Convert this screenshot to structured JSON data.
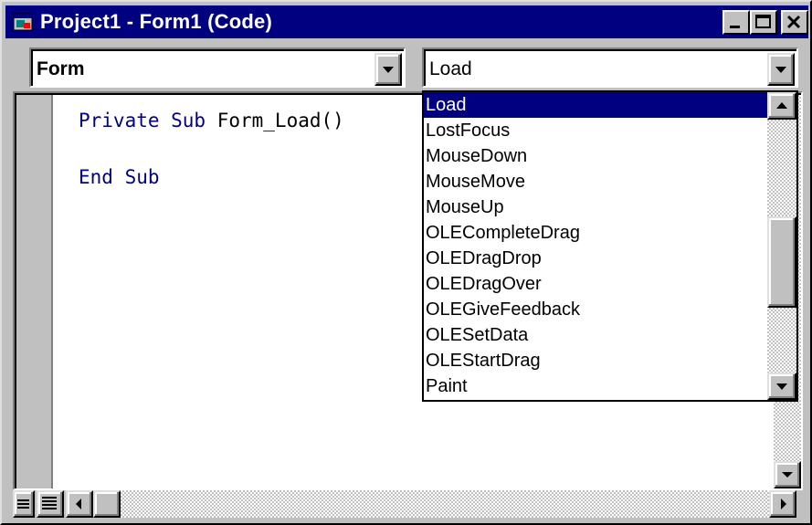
{
  "window": {
    "title": "Project1 - Form1 (Code)",
    "title_bg_color": "#000080",
    "face_color": "#c0c0c0"
  },
  "object_combo": {
    "value": "Form"
  },
  "procedure_combo": {
    "value": "Load",
    "expanded": true,
    "items": [
      "Load",
      "LostFocus",
      "MouseDown",
      "MouseMove",
      "MouseUp",
      "OLECompleteDrag",
      "OLEDragDrop",
      "OLEDragOver",
      "OLEGiveFeedback",
      "OLESetData",
      "OLEStartDrag",
      "Paint"
    ],
    "selected_index": 0,
    "selection_color": "#000080",
    "scroll_position": 0.6
  },
  "code": {
    "keyword_color": "#000080",
    "line1": {
      "kw": "Private Sub",
      "rest": " Form_Load()"
    },
    "line2": {
      "kw": "End Sub"
    }
  },
  "icons": {
    "app": "vb-form-icon",
    "minimize": "minimize-icon",
    "maximize": "maximize-icon",
    "close": "close-icon",
    "procedure_view": "procedure-view-icon",
    "full_module_view": "full-module-view-icon"
  }
}
